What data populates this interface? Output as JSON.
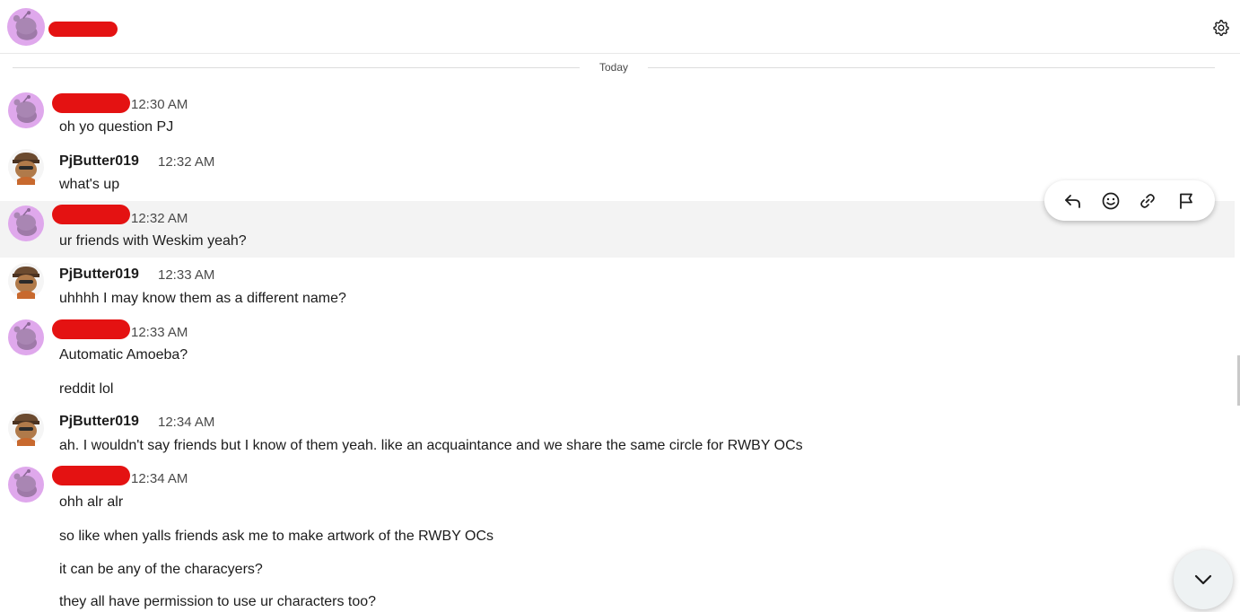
{
  "header": {
    "icons": {
      "avatar": "snoo-avatar",
      "settings": "gear-icon"
    }
  },
  "divider": {
    "label": "Today"
  },
  "messages": [
    {
      "time": "12:30 AM",
      "text": "oh yo question PJ"
    },
    {
      "name": "PjButter019",
      "time": "12:32 AM",
      "text": "what's up"
    },
    {
      "time": "12:32 AM",
      "text": "ur friends with Weskim yeah?"
    },
    {
      "name": "PjButter019",
      "time": "12:33 AM",
      "text": "uhhhh I may know them as a different name?"
    },
    {
      "time": "12:33 AM",
      "text": "Automatic Amoeba?"
    },
    {
      "text": "reddit lol"
    },
    {
      "name": "PjButter019",
      "time": "12:34 AM",
      "text": "ah. I wouldn't say friends but I know of them yeah. like an acquaintance and we share the same circle for RWBY OCs"
    },
    {
      "time": "12:34 AM",
      "text": "ohh alr alr"
    },
    {
      "text": "so like when yalls friends ask me to make artwork of the RWBY OCs"
    },
    {
      "text": "it can be any of the characyers?"
    },
    {
      "text": "they all have permission to use ur characters too?"
    }
  ],
  "toolbar_icons": [
    "reply-icon",
    "emoji-icon",
    "link-icon",
    "flag-icon"
  ],
  "colors": {
    "redaction": "#e41212",
    "avatar_purple": "#d9a3e8",
    "hover_row": "#f3f3f3"
  }
}
